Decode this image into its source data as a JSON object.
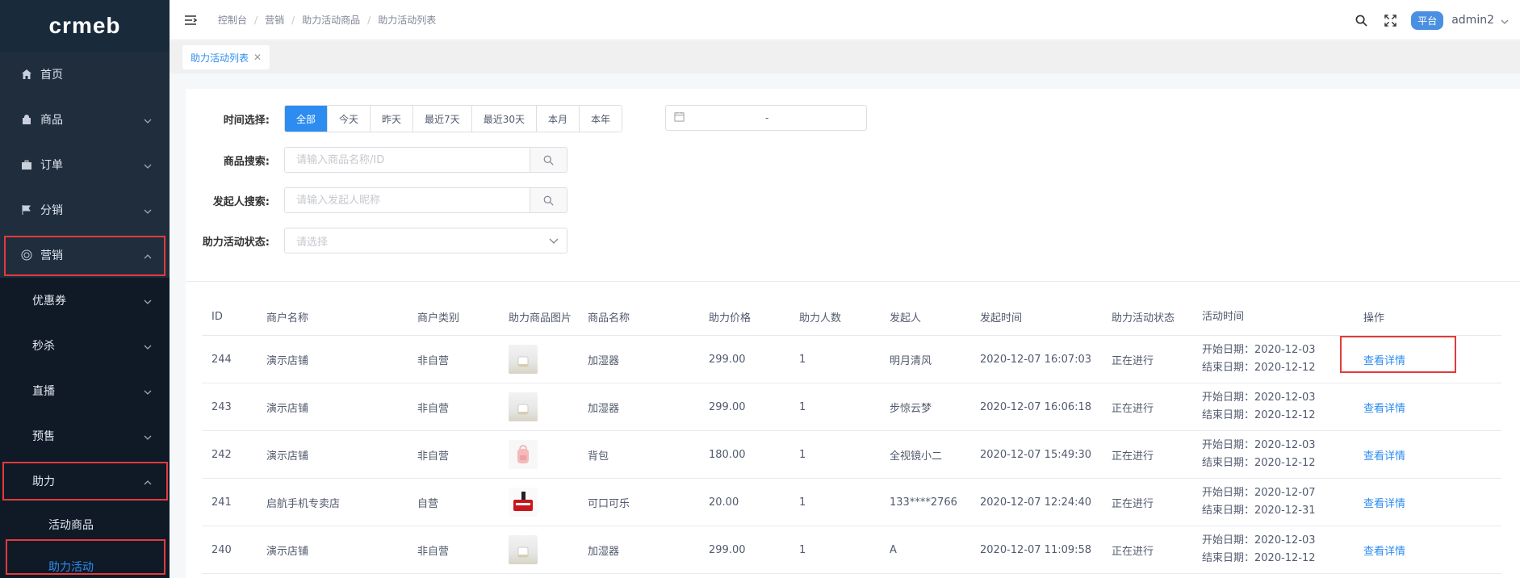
{
  "app": {
    "logo": "crmeb"
  },
  "sidebar": {
    "items": [
      {
        "label": "首页",
        "icon": "home-icon"
      },
      {
        "label": "商品",
        "icon": "bag-icon"
      },
      {
        "label": "订单",
        "icon": "briefcase-icon"
      },
      {
        "label": "分销",
        "icon": "flag-icon"
      },
      {
        "label": "营销",
        "icon": "target-icon"
      }
    ],
    "marketing_sub": [
      {
        "label": "优惠券"
      },
      {
        "label": "秒杀"
      },
      {
        "label": "直播"
      },
      {
        "label": "预售"
      },
      {
        "label": "助力"
      }
    ],
    "assist_sub": [
      {
        "label": "活动商品"
      },
      {
        "label": "助力活动"
      }
    ]
  },
  "header": {
    "breadcrumb": [
      "控制台",
      "营销",
      "助力活动商品",
      "助力活动列表"
    ],
    "platform": "平台",
    "user": "admin2"
  },
  "tabs": [
    {
      "label": "助力活动列表"
    }
  ],
  "filters": {
    "time_label": "时间选择:",
    "time_options": [
      "全部",
      "今天",
      "昨天",
      "最近7天",
      "最近30天",
      "本月",
      "本年"
    ],
    "date_range_dash": "-",
    "product_label": "商品搜索:",
    "product_placeholder": "请输入商品名称/ID",
    "initiator_label": "发起人搜索:",
    "initiator_placeholder": "请输入发起人昵称",
    "status_label": "助力活动状态:",
    "status_placeholder": "请选择"
  },
  "table": {
    "headers": [
      "ID",
      "商户名称",
      "商户类别",
      "助力商品图片",
      "商品名称",
      "助力价格",
      "助力人数",
      "发起人",
      "发起时间",
      "助力活动状态",
      "活动时间",
      "操作"
    ],
    "rows": [
      {
        "id": "244",
        "merchant": "演示店铺",
        "type": "非自营",
        "img": "humidifier",
        "name": "加湿器",
        "price": "299.00",
        "count": "1",
        "user": "明月清风",
        "time": "2020-12-07 16:07:03",
        "status": "正在进行",
        "start": "开始日期：2020-12-03",
        "end": "结束日期：2020-12-12",
        "op": "查看详情"
      },
      {
        "id": "243",
        "merchant": "演示店铺",
        "type": "非自营",
        "img": "humidifier",
        "name": "加湿器",
        "price": "299.00",
        "count": "1",
        "user": "步惊云梦",
        "time": "2020-12-07 16:06:18",
        "status": "正在进行",
        "start": "开始日期：2020-12-03",
        "end": "结束日期：2020-12-12",
        "op": "查看详情"
      },
      {
        "id": "242",
        "merchant": "演示店铺",
        "type": "非自营",
        "img": "backpack",
        "name": "背包",
        "price": "180.00",
        "count": "1",
        "user": "全视镜小二",
        "time": "2020-12-07 15:49:30",
        "status": "正在进行",
        "start": "开始日期：2020-12-03",
        "end": "结束日期：2020-12-12",
        "op": "查看详情"
      },
      {
        "id": "241",
        "merchant": "启航手机专卖店",
        "type": "自营",
        "img": "cola",
        "name": "可口可乐",
        "price": "20.00",
        "count": "1",
        "user": "133****2766",
        "time": "2020-12-07 12:24:40",
        "status": "正在进行",
        "start": "开始日期：2020-12-07",
        "end": "结束日期：2020-12-31",
        "op": "查看详情"
      },
      {
        "id": "240",
        "merchant": "演示店铺",
        "type": "非自营",
        "img": "humidifier",
        "name": "加湿器",
        "price": "299.00",
        "count": "1",
        "user": "A",
        "time": "2020-12-07 11:09:58",
        "status": "正在进行",
        "start": "开始日期：2020-12-03",
        "end": "结束日期：2020-12-12",
        "op": "查看详情"
      }
    ]
  },
  "colors": {
    "sidebar_bg": "#1f2d3d",
    "accent": "#2d8cf0",
    "highlight_box": "#e23b3b"
  }
}
